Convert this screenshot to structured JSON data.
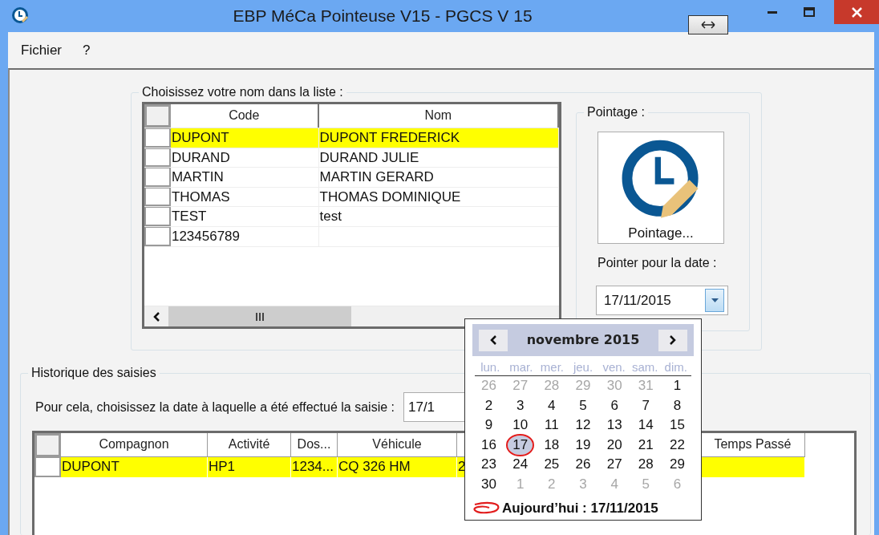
{
  "window": {
    "title": "EBP MéCa Pointeuse V15 - PGCS V 15"
  },
  "menu": [
    {
      "label": "Fichier"
    },
    {
      "label": "?"
    }
  ],
  "employee_list": {
    "legend": "Choisissez votre nom dans la liste :",
    "columns": [
      "Code",
      "Nom"
    ],
    "rows": [
      {
        "code": "DUPONT",
        "name": "DUPONT FREDERICK",
        "selected": true
      },
      {
        "code": "DURAND",
        "name": "DURAND JULIE",
        "selected": false
      },
      {
        "code": "MARTIN",
        "name": "MARTIN GERARD",
        "selected": false
      },
      {
        "code": "THOMAS",
        "name": "THOMAS DOMINIQUE",
        "selected": false
      },
      {
        "code": "TEST",
        "name": "test",
        "selected": false
      },
      {
        "code": "123456789",
        "name": null,
        "selected": false
      }
    ]
  },
  "pointage": {
    "legend": "Pointage :",
    "button_label": "Pointage...",
    "date_label": "Pointer pour la date :",
    "date_value": "17/11/2015"
  },
  "history": {
    "legend": "Historique des saisies",
    "date_prompt": "Pour cela, choisissez la date à laquelle a été effectué la saisie :",
    "date_value": "17/1",
    "columns": [
      "Compagnon",
      "Activité",
      "Dos...",
      "Véhicule",
      null,
      "Temps Passé"
    ],
    "rows": [
      {
        "selected": true,
        "cells": [
          "DUPONT",
          "HP1",
          "1234...",
          "CQ 326 HM",
          "2",
          null
        ]
      }
    ]
  },
  "calendar": {
    "month": "novembre 2015",
    "weekdays": [
      "lun.",
      "mar.",
      "mer.",
      "jeu.",
      "ven.",
      "sam.",
      "dim."
    ],
    "weeks": [
      [
        {
          "day": "26",
          "in_month": false,
          "selected": false,
          "today": false
        },
        {
          "day": "27",
          "in_month": false,
          "selected": false,
          "today": false
        },
        {
          "day": "28",
          "in_month": false,
          "selected": false,
          "today": false
        },
        {
          "day": "29",
          "in_month": false,
          "selected": false,
          "today": false
        },
        {
          "day": "30",
          "in_month": false,
          "selected": false,
          "today": false
        },
        {
          "day": "31",
          "in_month": false,
          "selected": false,
          "today": false
        },
        {
          "day": "1",
          "in_month": true,
          "selected": false,
          "today": false
        }
      ],
      [
        {
          "day": "2",
          "in_month": true,
          "selected": false,
          "today": false
        },
        {
          "day": "3",
          "in_month": true,
          "selected": false,
          "today": false
        },
        {
          "day": "4",
          "in_month": true,
          "selected": false,
          "today": false
        },
        {
          "day": "5",
          "in_month": true,
          "selected": false,
          "today": false
        },
        {
          "day": "6",
          "in_month": true,
          "selected": false,
          "today": false
        },
        {
          "day": "7",
          "in_month": true,
          "selected": false,
          "today": false
        },
        {
          "day": "8",
          "in_month": true,
          "selected": false,
          "today": false
        }
      ],
      [
        {
          "day": "9",
          "in_month": true,
          "selected": false,
          "today": false
        },
        {
          "day": "10",
          "in_month": true,
          "selected": false,
          "today": false
        },
        {
          "day": "11",
          "in_month": true,
          "selected": false,
          "today": false
        },
        {
          "day": "12",
          "in_month": true,
          "selected": false,
          "today": false
        },
        {
          "day": "13",
          "in_month": true,
          "selected": false,
          "today": false
        },
        {
          "day": "14",
          "in_month": true,
          "selected": false,
          "today": false
        },
        {
          "day": "15",
          "in_month": true,
          "selected": false,
          "today": false
        }
      ],
      [
        {
          "day": "16",
          "in_month": true,
          "selected": false,
          "today": false
        },
        {
          "day": "17",
          "in_month": true,
          "selected": true,
          "today": true
        },
        {
          "day": "18",
          "in_month": true,
          "selected": false,
          "today": false
        },
        {
          "day": "19",
          "in_month": true,
          "selected": false,
          "today": false
        },
        {
          "day": "20",
          "in_month": true,
          "selected": false,
          "today": false
        },
        {
          "day": "21",
          "in_month": true,
          "selected": false,
          "today": false
        },
        {
          "day": "22",
          "in_month": true,
          "selected": false,
          "today": false
        }
      ],
      [
        {
          "day": "23",
          "in_month": true,
          "selected": false,
          "today": false
        },
        {
          "day": "24",
          "in_month": true,
          "selected": false,
          "today": false
        },
        {
          "day": "25",
          "in_month": true,
          "selected": false,
          "today": false
        },
        {
          "day": "26",
          "in_month": true,
          "selected": false,
          "today": false
        },
        {
          "day": "27",
          "in_month": true,
          "selected": false,
          "today": false
        },
        {
          "day": "28",
          "in_month": true,
          "selected": false,
          "today": false
        },
        {
          "day": "29",
          "in_month": true,
          "selected": false,
          "today": false
        }
      ],
      [
        {
          "day": "30",
          "in_month": true,
          "selected": false,
          "today": false
        },
        {
          "day": "1",
          "in_month": false,
          "selected": false,
          "today": false
        },
        {
          "day": "2",
          "in_month": false,
          "selected": false,
          "today": false
        },
        {
          "day": "3",
          "in_month": false,
          "selected": false,
          "today": false
        },
        {
          "day": "4",
          "in_month": false,
          "selected": false,
          "today": false
        },
        {
          "day": "5",
          "in_month": false,
          "selected": false,
          "today": false
        },
        {
          "day": "6",
          "in_month": false,
          "selected": false,
          "today": false
        }
      ]
    ],
    "today_label": "Aujourd’hui : 17/11/2015"
  }
}
